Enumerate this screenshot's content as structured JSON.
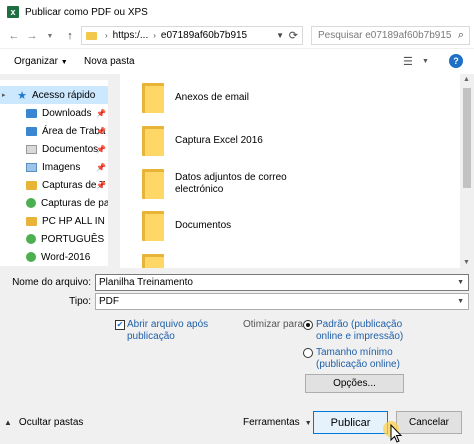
{
  "window": {
    "title": "Publicar como PDF ou XPS",
    "icon": "excel-icon"
  },
  "address": {
    "path": [
      "https:/...",
      "e07189af60b7b915"
    ],
    "search_placeholder": "Pesquisar e07189af60b7b915"
  },
  "toolbar": {
    "organize": "Organizar",
    "new_folder": "Nova pasta",
    "help": "?"
  },
  "nav": {
    "items": [
      {
        "label": "Acesso rápido",
        "icon": "star-icon",
        "selected": true,
        "pinned": false
      },
      {
        "label": "Downloads",
        "icon": "download-icon",
        "pinned": true
      },
      {
        "label": "Área de Traba",
        "icon": "desktop-folder-icon",
        "pinned": true
      },
      {
        "label": "Documentos",
        "icon": "documents-icon",
        "pinned": true
      },
      {
        "label": "Imagens",
        "icon": "images-icon",
        "pinned": true
      },
      {
        "label": "Capturas de T",
        "icon": "folder-icon",
        "pinned": true
      },
      {
        "label": "Capturas de pan",
        "icon": "sync-folder-icon",
        "pinned": false
      },
      {
        "label": "PC HP ALL IN ON",
        "icon": "folder-icon",
        "pinned": false
      },
      {
        "label": "PORTUGUÊS",
        "icon": "sync-folder-icon",
        "pinned": false
      },
      {
        "label": "Word-2016",
        "icon": "sync-folder-icon",
        "pinned": false
      }
    ]
  },
  "files": [
    {
      "name": "Anexos de email"
    },
    {
      "name": "Captura Excel 2016"
    },
    {
      "name": "Datos adjuntos de correo electrónico"
    },
    {
      "name": "Documentos"
    }
  ],
  "form": {
    "filename_label": "Nome do arquivo:",
    "filename_value": "Planilha Treinamento",
    "type_label": "Tipo:",
    "type_value": "PDF",
    "open_after_label": "Abrir arquivo após publicação",
    "open_after_checked": true,
    "optimize_label": "Otimizar para:",
    "option_standard": "Padrão (publicação online e impressão)",
    "option_minimum": "Tamanho mínimo (publicação online)",
    "options_button": "Opções...",
    "hide_folders": "Ocultar pastas",
    "tools": "Ferramentas",
    "publish": "Publicar",
    "cancel": "Cancelar"
  },
  "colors": {
    "accent": "#0078d7",
    "link": "#1e5fa8",
    "folder": "#ffd766",
    "selection": "#cce8ff"
  }
}
